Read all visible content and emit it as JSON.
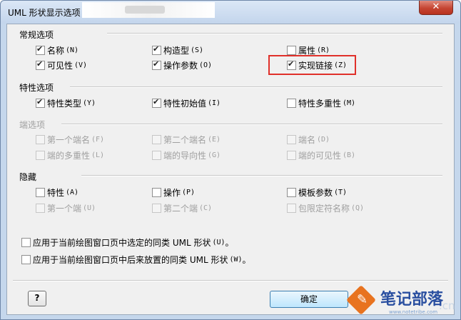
{
  "window": {
    "title": "UML 形状显示选项",
    "close_glyph": "✕"
  },
  "general": {
    "title": "常规选项",
    "items": [
      {
        "label": "名称",
        "shortcut": "(N)",
        "checked": true
      },
      {
        "label": "构造型",
        "shortcut": "(S)",
        "checked": true
      },
      {
        "label": "属性",
        "shortcut": "(R)",
        "checked": false
      },
      {
        "label": "可见性",
        "shortcut": "(V)",
        "checked": true
      },
      {
        "label": "操作参数",
        "shortcut": "(O)",
        "checked": true
      },
      {
        "label": "实现链接",
        "shortcut": "(Z)",
        "checked": true
      }
    ]
  },
  "attribute": {
    "title": "特性选项",
    "items": [
      {
        "label": "特性类型",
        "shortcut": "(Y)",
        "checked": true
      },
      {
        "label": "特性初始值",
        "shortcut": "(I)",
        "checked": true
      },
      {
        "label": "特性多重性",
        "shortcut": "(M)",
        "checked": false
      }
    ]
  },
  "end": {
    "title": "端选项",
    "items": [
      {
        "label": "第一个端名",
        "shortcut": "(F)",
        "checked": false
      },
      {
        "label": "第二个端名",
        "shortcut": "(E)",
        "checked": false
      },
      {
        "label": "端名",
        "shortcut": "(D)",
        "checked": false
      },
      {
        "label": "端的多重性",
        "shortcut": "(L)",
        "checked": false
      },
      {
        "label": "端的导向性",
        "shortcut": "(G)",
        "checked": false
      },
      {
        "label": "端的可见性",
        "shortcut": "(B)",
        "checked": false
      }
    ]
  },
  "hide": {
    "title": "隐藏",
    "items": [
      {
        "label": "特性",
        "shortcut": "(A)",
        "checked": false
      },
      {
        "label": "操作",
        "shortcut": "(P)",
        "checked": false
      },
      {
        "label": "模板参数",
        "shortcut": "(T)",
        "checked": false
      },
      {
        "label": "第一个端",
        "shortcut": "(U)",
        "checked": false
      },
      {
        "label": "第二个端",
        "shortcut": "(C)",
        "checked": false
      },
      {
        "label": "包限定符名称",
        "shortcut": "(Q)",
        "checked": false
      }
    ]
  },
  "apply": {
    "selected": {
      "label": "应用于当前绘图窗口页中选定的同类 UML 形状",
      "shortcut": "(U)",
      "suffix": "。",
      "checked": false
    },
    "later": {
      "label": "应用于当前绘图窗口页中后来放置的同类 UML 形状",
      "shortcut": "(W)",
      "suffix": "。",
      "checked": false
    }
  },
  "buttons": {
    "help_glyph": "?",
    "ok_label": "确定"
  },
  "watermark": {
    "name": "笔记部落",
    "url": "www.notetribe.com",
    "cn": ".cn"
  }
}
